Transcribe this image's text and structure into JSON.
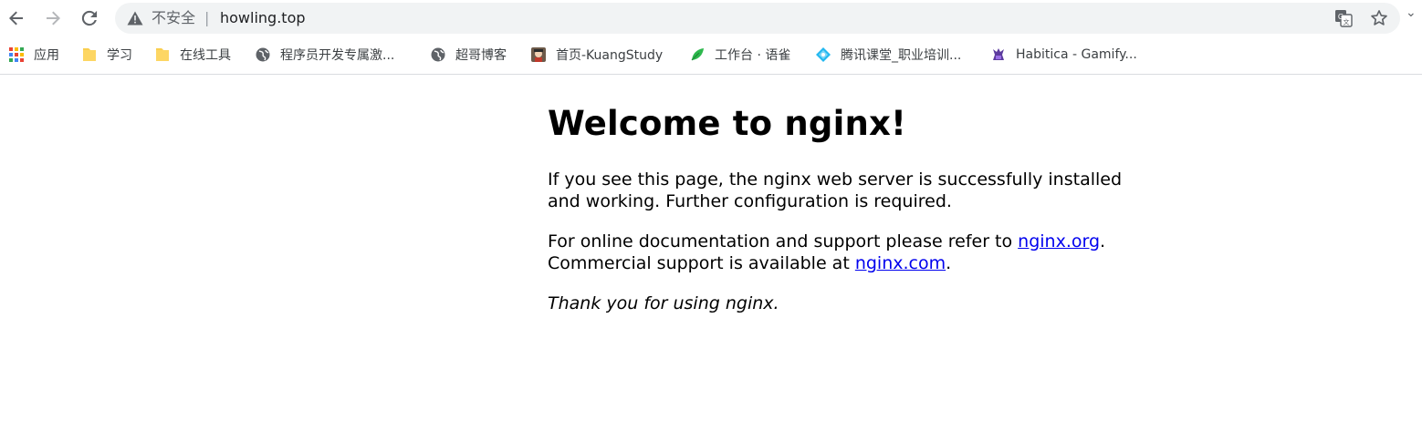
{
  "toolbar": {
    "back_icon": "back-arrow-icon",
    "forward_icon": "forward-arrow-icon",
    "reload_icon": "reload-icon"
  },
  "omnibox": {
    "security_icon": "warning-triangle-icon",
    "security_label": "不安全",
    "separator": "|",
    "url": "howling.top",
    "translate_icon": "translate-icon",
    "bookmark_icon": "star-icon"
  },
  "bookmarks": [
    {
      "label": "应用",
      "icon": "apps-grid-icon"
    },
    {
      "label": "学习",
      "icon": "folder-icon"
    },
    {
      "label": "在线工具",
      "icon": "folder-icon"
    },
    {
      "label": "程序员开发专属激...",
      "icon": "globe-icon"
    },
    {
      "label": "超哥博客",
      "icon": "globe-icon"
    },
    {
      "label": "首页-KuangStudy",
      "icon": "avatar-favicon-icon"
    },
    {
      "label": "工作台 · 语雀",
      "icon": "yuque-leaf-icon"
    },
    {
      "label": "腾讯课堂_职业培训...",
      "icon": "tencent-classroom-icon"
    },
    {
      "label": "Habitica - Gamify...",
      "icon": "habitica-icon"
    }
  ],
  "page": {
    "heading": "Welcome to nginx!",
    "p1": "If you see this page, the nginx web server is successfully installed and working. Further configuration is required.",
    "p2_before": "For online documentation and support please refer to ",
    "p2_link1": "nginx.org",
    "p2_mid": ".",
    "p2_line2": "Commercial support is available at ",
    "p2_link2": "nginx.com",
    "p2_end": ".",
    "p3": "Thank you for using nginx."
  },
  "colors": {
    "link": "#0000ee",
    "text": "#000000",
    "omnibox_bg": "#f1f3f4",
    "chrome_icon": "#5f6368"
  }
}
